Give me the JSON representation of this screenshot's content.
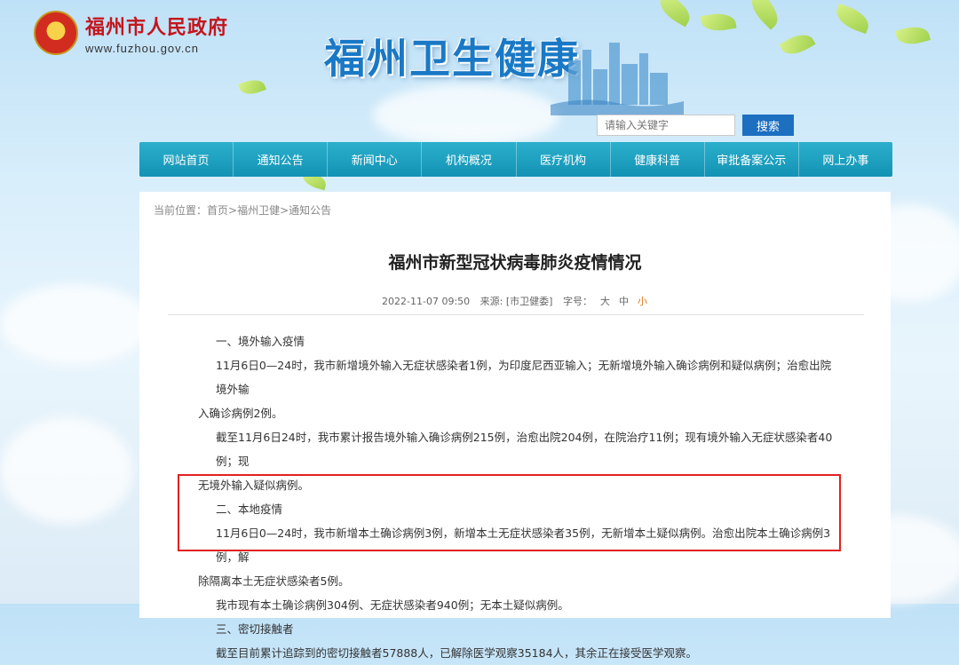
{
  "header": {
    "gov_name": "福州市人民政府",
    "gov_url": "www.fuzhou.gov.cn",
    "site_title": "福州卫生健康"
  },
  "search": {
    "placeholder": "请输入关键字",
    "button_label": "搜索"
  },
  "nav": {
    "items": [
      "网站首页",
      "通知公告",
      "新闻中心",
      "机构概况",
      "医疗机构",
      "健康科普",
      "审批备案公示",
      "网上办事"
    ]
  },
  "breadcrumb": {
    "prefix": "当前位置：",
    "items": [
      "首页",
      "福州卫健",
      "通知公告"
    ]
  },
  "article": {
    "title": "福州市新型冠状病毒肺炎疫情情况",
    "date": "2022-11-07 09:50",
    "source": "来源: [市卫健委]",
    "font_size_label": "字号：",
    "font_sizes": [
      "大",
      "中",
      "小"
    ],
    "paragraphs": [
      "一、境外输入疫情",
      "11月6日0—24时，我市新增境外输入无症状感染者1例，为印度尼西亚输入；无新增境外输入确诊病例和疑似病例；治愈出院境外输",
      "入确诊病例2例。",
      "截至11月6日24时，我市累计报告境外输入确诊病例215例，治愈出院204例，在院治疗11例；现有境外输入无症状感染者40例；现",
      "无境外输入疑似病例。",
      "二、本地疫情",
      "11月6日0—24时，我市新增本土确诊病例3例，新增本土无症状感染者35例，无新增本土疑似病例。治愈出院本土确诊病例3例，解",
      "除隔离本土无症状感染者5例。",
      "我市现有本土确诊病例304例、无症状感染者940例；无本土疑似病例。",
      "三、密切接触者",
      "截至目前累计追踪到的密切接触者57888人，已解除医学观察35184人，其余正在接受医学观察。"
    ]
  },
  "colors": {
    "nav_bg": "#1a9fc0",
    "search_button": "#1d6fc0",
    "title_blue": "#1a79c6",
    "gov_red": "#c3161c",
    "highlight_border": "#e02020",
    "active_font_size": "#e07a1a"
  }
}
